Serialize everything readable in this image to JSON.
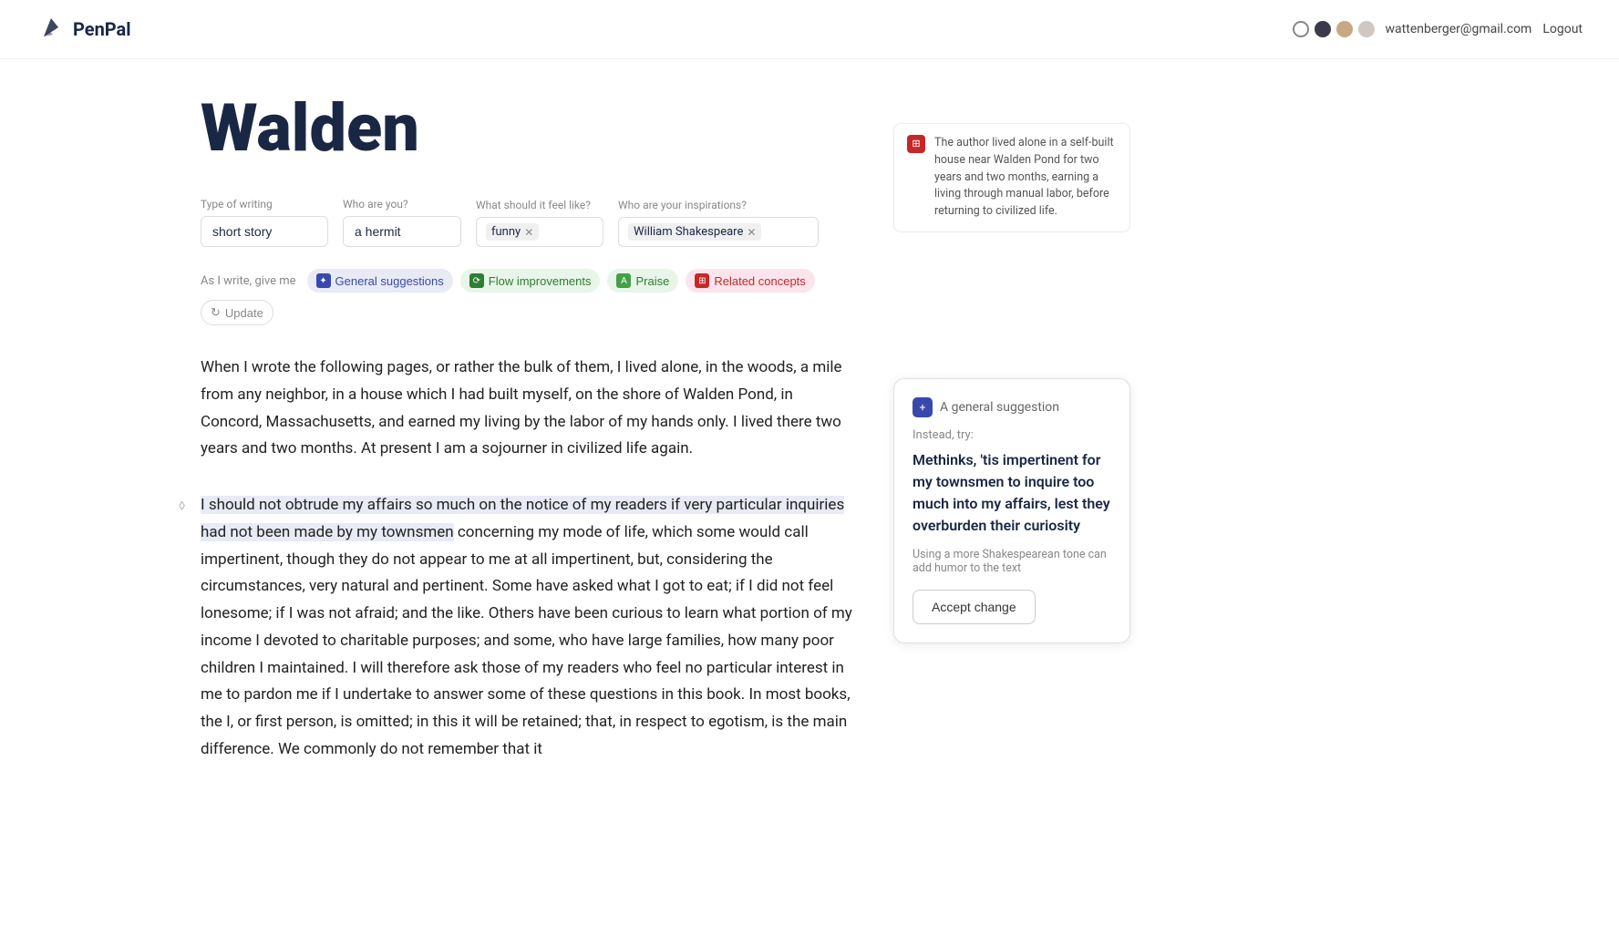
{
  "app": {
    "name": "PenPal"
  },
  "navbar": {
    "email": "wattenberger@gmail.com",
    "logout_label": "Logout",
    "circles": [
      "outline",
      "dark",
      "tan",
      "light"
    ]
  },
  "document": {
    "title": "Walden"
  },
  "filters": {
    "type_of_writing_label": "Type of writing",
    "type_of_writing_value": "short story",
    "who_are_you_label": "Who are you?",
    "who_are_you_value": "a hermit",
    "feel_like_label": "What should it feel like?",
    "feel_like_value": "funny",
    "inspirations_label": "Who are your inspirations?",
    "inspiration_value": "William Shakespeare"
  },
  "toolbar": {
    "prefix": "As I write, give me",
    "buttons": [
      {
        "id": "general",
        "label": "General suggestions",
        "icon": "✦",
        "style": "general"
      },
      {
        "id": "flow",
        "label": "Flow improvements",
        "icon": "⟳",
        "style": "flow"
      },
      {
        "id": "praise",
        "label": "Praise",
        "icon": "A",
        "style": "praise"
      },
      {
        "id": "related",
        "label": "Related concepts",
        "icon": "⊞",
        "style": "related"
      },
      {
        "id": "update",
        "label": "Update",
        "icon": "↻",
        "style": "update"
      }
    ]
  },
  "paragraphs": {
    "first": "When I wrote the following pages, or rather the bulk of them, I lived alone, in the woods, a mile from any neighbor, in a house which I had built myself, on the shore of Walden Pond, in Concord, Massachusetts, and earned my living by the labor of my hands only. I lived there two years and two months. At present I am a sojourner in civilized life again.",
    "second_highlighted": "I should not obtrude my affairs so much on the notice of my readers if very particular inquiries had not been made by my townsmen",
    "second_rest": " concerning my mode of life, which some would call impertinent, though they do not appear to me at all impertinent, but, considering the circumstances, very natural and pertinent. Some have asked what I got to eat; if I did not feel lonesome; if I was not afraid; and the like. Others have been curious to learn what portion of my income I devoted to charitable purposes; and some, who have large families, how many poor children I maintained. I will therefore ask those of my readers who feel no particular interest in me to pardon me if I undertake to answer some of these questions in this book. In most books, the I, or first person, is omitted; in this it will be retained; that, in respect to egotism, is the main difference. We commonly do not remember that it"
  },
  "annotation": {
    "text": "The author lived alone in a self-built house near Walden Pond for two years and two months, earning a living through manual labor, before returning to civilized life."
  },
  "suggestion_card": {
    "header": "A general suggestion",
    "instead_label": "Instead, try:",
    "suggestion_text": "Methinks, 'tis impertinent for my townsmen to inquire too much into my affairs, lest they overburden their curiosity",
    "note": "Using a more Shakespearean tone can add humor to the text",
    "accept_label": "Accept change"
  }
}
